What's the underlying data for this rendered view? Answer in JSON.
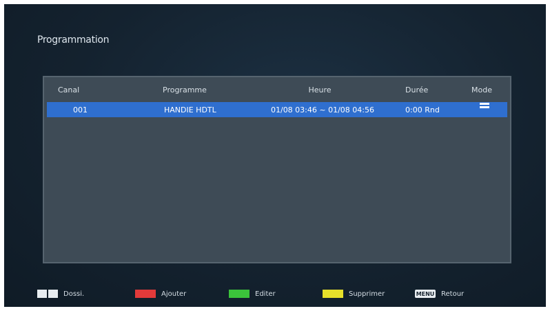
{
  "screen": {
    "title": "Programmation"
  },
  "table": {
    "headers": [
      "Canal",
      "Programme",
      "Heure",
      "Durée",
      "Mode"
    ],
    "rows": [
      {
        "channel": "001",
        "program": "HANDIE HDTL",
        "time": "01/08 03:46 ~ 01/08 04:56",
        "duration": "0:00 Rnd",
        "mode_icon": "repeat-icon"
      }
    ],
    "selected_row_color": "#2f6fcf"
  },
  "footer": {
    "items": [
      {
        "key_icon": "info-key-icon",
        "label": "Dossi."
      },
      {
        "key_icon": "red-key-icon",
        "label": "Ajouter",
        "color": "#e33a3a"
      },
      {
        "key_icon": "green-key-icon",
        "label": "Editer",
        "color": "#3bc43b"
      },
      {
        "key_icon": "yellow-key-icon",
        "label": "Supprimer",
        "color": "#e6e02a"
      },
      {
        "key_icon": "menu-key-icon",
        "key_text": "MENU",
        "label": "Retour"
      }
    ]
  }
}
